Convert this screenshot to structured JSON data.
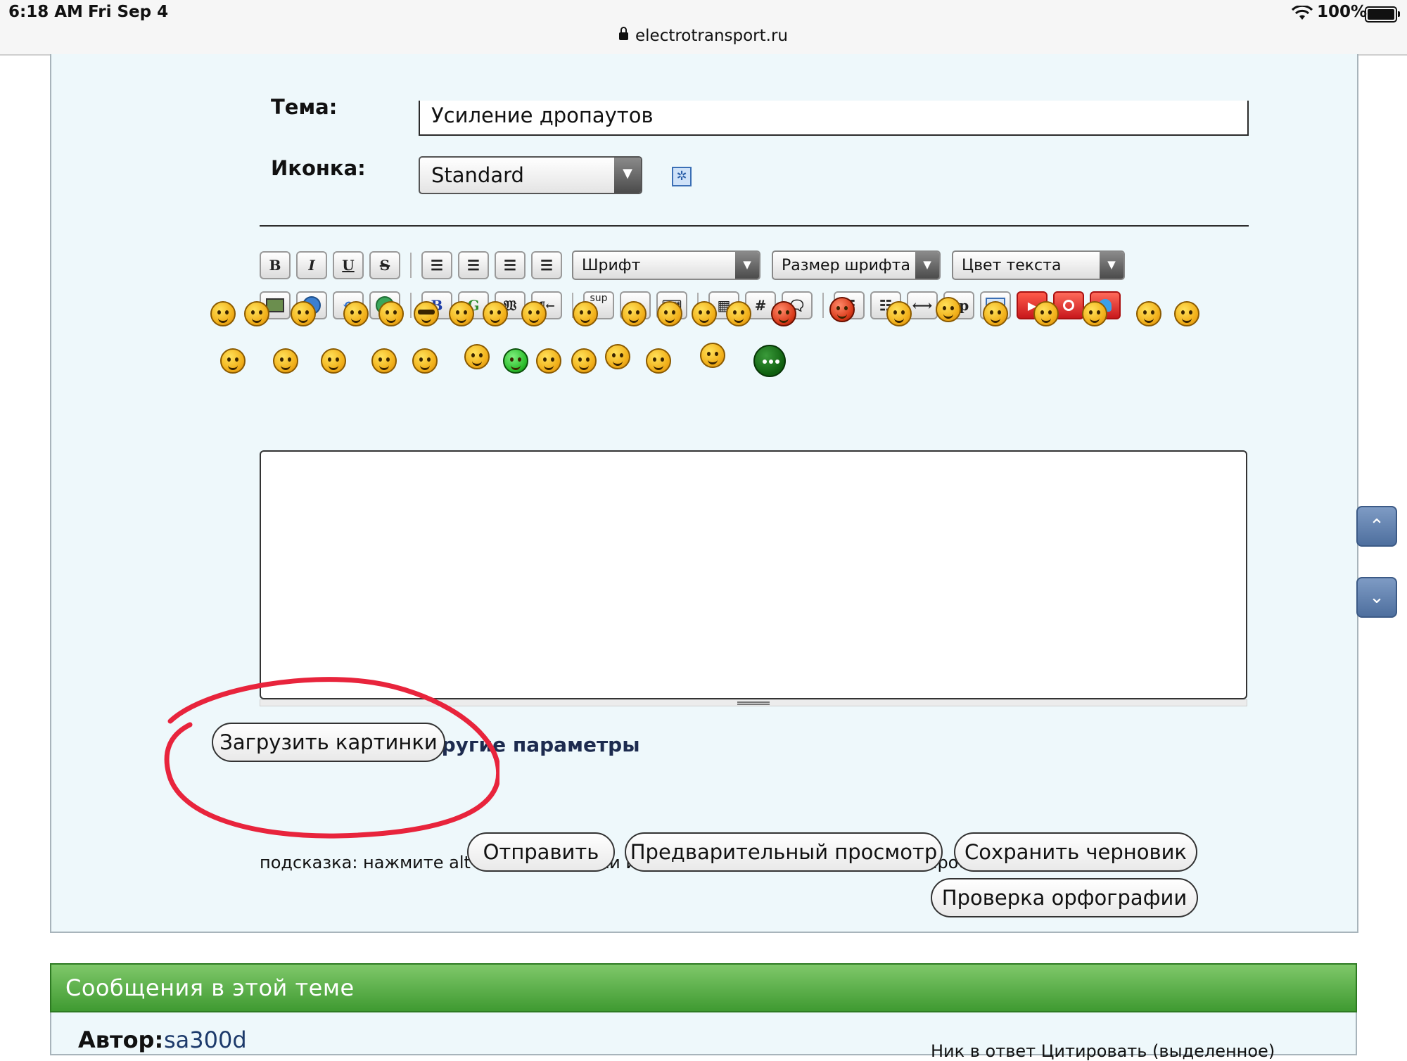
{
  "status_bar": {
    "time": "6:18 AM",
    "date": "Fri Sep 4",
    "url": "electrotransport.ru",
    "battery": "100%",
    "battery_level": 1.0,
    "icons": [
      "lock-icon",
      "wifi-icon",
      "battery-icon"
    ]
  },
  "form": {
    "subject_label": "Тема:",
    "subject_value": "Усиление дропаутов",
    "icon_label": "Иконка:",
    "icon_select_value": "Standard"
  },
  "toolbar": {
    "row1": [
      "bold",
      "italic",
      "underline",
      "strikethrough",
      "justify",
      "align-left",
      "align-center",
      "align-right"
    ],
    "font_select": "Шрифт",
    "size_select": "Размер шрифта",
    "color_select": "Цвет текста",
    "row2": [
      "image",
      "link",
      "email",
      "globe",
      "bold-blue",
      "google",
      "wiki",
      "indent",
      "sup",
      "sub",
      "spoiler",
      "table",
      "hash",
      "quote",
      "bullet-list",
      "numbered-list",
      "hr",
      "spoiler-sp",
      "card",
      "youtube",
      "search",
      "user"
    ],
    "sup_label": "sup",
    "sub_label": "sub",
    "bold_label": "B",
    "italic_label": "I",
    "underline_label": "U",
    "strike_label": "S",
    "g_label": "G",
    "sp_label": "Sp",
    "hash_label": "#"
  },
  "smilies": {
    "row1": [
      "smile",
      "smile",
      "smile",
      "smile",
      "grin",
      "cool",
      "confused",
      "smile",
      "wave",
      "think",
      "smile",
      "smile",
      "meh",
      "facepalm",
      "red",
      "devil",
      "fist",
      "lick",
      "meh",
      "angry",
      "scared",
      "headphones",
      "smile"
    ],
    "row2": [
      "smile",
      "smile",
      "smile",
      "laugh",
      "thumbsup",
      "flag",
      "green",
      "shock",
      "laugh",
      "crazy",
      "idea",
      "horns",
      "more"
    ]
  },
  "editor": {
    "content": ""
  },
  "attachments": {
    "label": "Вложения и другие параметры"
  },
  "buttons": {
    "upload": "Загрузить картинки",
    "hint": "подсказка: нажмите alt+s для отправки или alt+p для предварительного просмотра сообщения",
    "submit": "Отправить",
    "preview": "Предварительный просмотр",
    "save_draft": "Сохранить черновик",
    "spellcheck": "Проверка орфографии"
  },
  "messages": {
    "title": "Сообщения в этой теме",
    "author_label": "Автор:",
    "author_name": "sa300d",
    "actions": "Ник в ответ   Цитировать (выделенное)"
  },
  "colors": {
    "panel_bg": "#eef8fb",
    "header_green": "#4fa63c",
    "annotation_red": "#e8243c"
  }
}
